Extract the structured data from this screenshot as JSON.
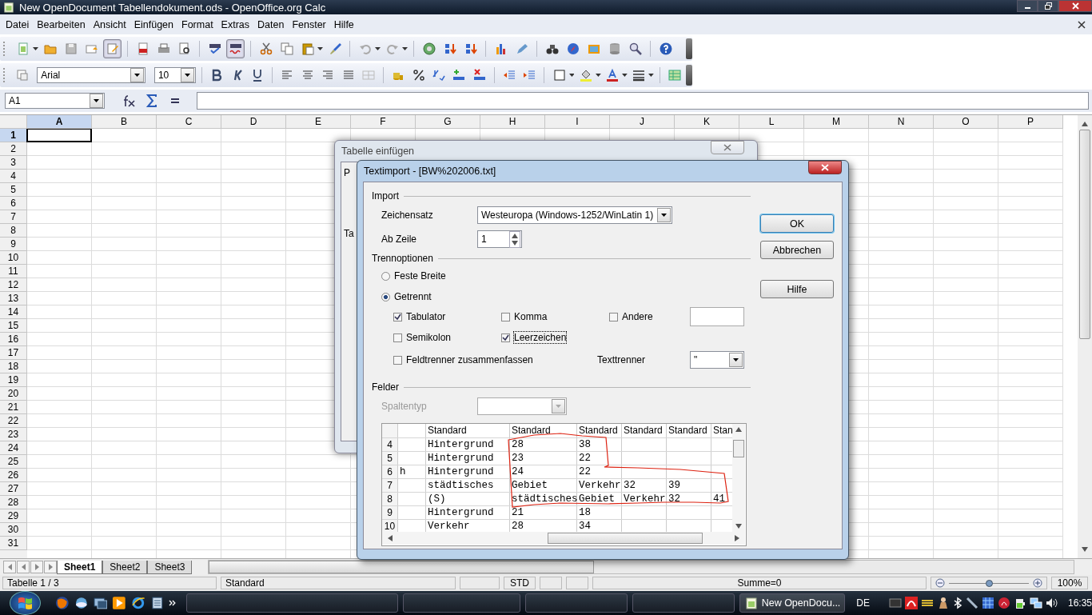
{
  "window": {
    "title": "New OpenDocument Tabellendokument.ods - OpenOffice.org Calc"
  },
  "menu": [
    "Datei",
    "Bearbeiten",
    "Ansicht",
    "Einfügen",
    "Format",
    "Extras",
    "Daten",
    "Fenster",
    "Hilfe"
  ],
  "formatting": {
    "font_name": "Arial",
    "font_size": "10"
  },
  "formula_bar": {
    "cell_reference": "A1"
  },
  "sheet": {
    "columns": [
      {
        "label": "A",
        "selected": true
      },
      {
        "label": "B",
        "selected": false
      },
      {
        "label": "C",
        "selected": false
      },
      {
        "label": "D",
        "selected": false
      },
      {
        "label": "E",
        "selected": false
      },
      {
        "label": "F",
        "selected": false
      },
      {
        "label": "G",
        "selected": false
      },
      {
        "label": "H",
        "selected": false
      },
      {
        "label": "I",
        "selected": false
      },
      {
        "label": "J",
        "selected": false
      },
      {
        "label": "K",
        "selected": false
      },
      {
        "label": "L",
        "selected": false
      },
      {
        "label": "M",
        "selected": false
      },
      {
        "label": "N",
        "selected": false
      },
      {
        "label": "O",
        "selected": false
      },
      {
        "label": "P",
        "selected": false
      }
    ],
    "rows": [
      {
        "label": "1",
        "selected": true
      },
      {
        "label": "2",
        "selected": false
      },
      {
        "label": "3",
        "selected": false
      },
      {
        "label": "4",
        "selected": false
      },
      {
        "label": "5",
        "selected": false
      },
      {
        "label": "6",
        "selected": false
      },
      {
        "label": "7",
        "selected": false
      },
      {
        "label": "8",
        "selected": false
      },
      {
        "label": "9",
        "selected": false
      },
      {
        "label": "10",
        "selected": false
      },
      {
        "label": "11",
        "selected": false
      },
      {
        "label": "12",
        "selected": false
      },
      {
        "label": "13",
        "selected": false
      },
      {
        "label": "14",
        "selected": false
      },
      {
        "label": "15",
        "selected": false
      },
      {
        "label": "16",
        "selected": false
      },
      {
        "label": "17",
        "selected": false
      },
      {
        "label": "18",
        "selected": false
      },
      {
        "label": "19",
        "selected": false
      },
      {
        "label": "20",
        "selected": false
      },
      {
        "label": "21",
        "selected": false
      },
      {
        "label": "22",
        "selected": false
      },
      {
        "label": "23",
        "selected": false
      },
      {
        "label": "24",
        "selected": false
      },
      {
        "label": "25",
        "selected": false
      },
      {
        "label": "26",
        "selected": false
      },
      {
        "label": "27",
        "selected": false
      },
      {
        "label": "28",
        "selected": false
      },
      {
        "label": "29",
        "selected": false
      },
      {
        "label": "30",
        "selected": false
      },
      {
        "label": "31",
        "selected": false
      }
    ]
  },
  "sheet_tabs": [
    {
      "label": "Sheet1",
      "selected": true
    },
    {
      "label": "Sheet2",
      "selected": false
    },
    {
      "label": "Sheet3",
      "selected": false
    }
  ],
  "status_bar": {
    "sheet": "Tabelle 1 / 3",
    "page_style": "Standard",
    "selection_mode": "STD",
    "sum": "Summe=0",
    "zoom": {
      "level": 0.5,
      "reading": "100%"
    }
  },
  "background_dialog": {
    "title": "Tabelle einfügen",
    "visible_labels": [
      "P",
      "Ta"
    ]
  },
  "text_import": {
    "title": "Textimport - [BW%202006.txt]",
    "import_section": {
      "heading": "Import",
      "charset_label": "Zeichensatz",
      "charset": "Westeuropa (Windows-1252/WinLatin 1)",
      "from_row_label": "Ab Zeile",
      "from_row": "1"
    },
    "separator_section": {
      "heading": "Trennoptionen",
      "modes": [
        {
          "label": "Feste Breite",
          "selected": false
        },
        {
          "label": "Getrennt",
          "selected": true
        }
      ],
      "separators": [
        {
          "label": "Tabulator",
          "checked": true,
          "focused": false
        },
        {
          "label": "Komma",
          "checked": false,
          "focused": false
        },
        {
          "label": "Andere",
          "checked": false,
          "focused": false
        },
        {
          "label": "Semikolon",
          "checked": false,
          "focused": false
        },
        {
          "label": "Leerzeichen",
          "checked": true,
          "focused": true
        }
      ],
      "merge_delimiters": {
        "label": "Feldtrenner zusammenfassen",
        "checked": false
      },
      "text_delimiter_label": "Texttrenner",
      "text_delimiter": "\""
    },
    "fields_section": {
      "heading": "Felder",
      "column_type_label": "Spaltentyp",
      "column_type_disabled": true,
      "preview": {
        "columns": [
          null,
          "Standard",
          "Standard",
          "Standard",
          "Standard",
          "Standard",
          "Stan"
        ],
        "rows": [
          {
            "number": "4",
            "cells": [
              null,
              "Hintergrund",
              "28",
              "38",
              null,
              null,
              null
            ]
          },
          {
            "number": "5",
            "cells": [
              null,
              "Hintergrund",
              "23",
              "22",
              null,
              null,
              null
            ]
          },
          {
            "number": "6",
            "cells": [
              "h",
              "Hintergrund",
              "24",
              "22",
              null,
              null,
              null
            ]
          },
          {
            "number": "7",
            "cells": [
              null,
              "städtisches",
              "Gebiet",
              "Verkehr",
              "32",
              "39",
              null
            ]
          },
          {
            "number": "8",
            "cells": [
              null,
              "(S)",
              "städtisches",
              "Gebiet",
              "Verkehr",
              "32",
              "41"
            ]
          },
          {
            "number": "9",
            "cells": [
              null,
              "Hintergrund",
              "21",
              "18",
              null,
              null,
              null
            ]
          },
          {
            "number": "10",
            "cells": [
              null,
              "Verkehr",
              "28",
              "34",
              null,
              null,
              null
            ]
          }
        ]
      }
    },
    "buttons": [
      {
        "label": "OK",
        "default": true
      },
      {
        "label": "Abbrechen",
        "default": false
      },
      {
        "label": "Hilfe",
        "default": false
      }
    ]
  },
  "taskbar": {
    "active_task": "New OpenDocu...",
    "language": "DE",
    "clock": "16:35"
  }
}
